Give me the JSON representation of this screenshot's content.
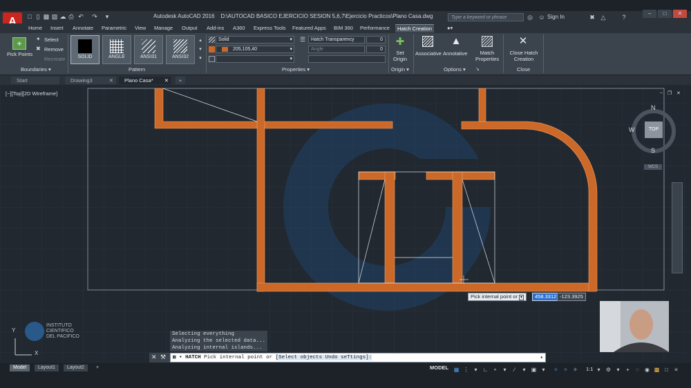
{
  "app": {
    "title": "Autodesk AutoCAD 2016",
    "file_path": "D:\\AUTOCAD BASICO EJERCICIO SESION 5,6,7\\Ejercicio Practicos\\Plano Casa.dwg",
    "search_placeholder": "Type a keyword or phrase",
    "signin": "Sign In",
    "logo_letter": "A"
  },
  "ribbon_tabs": [
    "Home",
    "Insert",
    "Annotate",
    "Parametric",
    "View",
    "Manage",
    "Output",
    "Add-ins",
    "A360",
    "Express Tools",
    "Featured Apps",
    "BIM 360",
    "Performance",
    "Hatch Creation"
  ],
  "ribbon": {
    "boundaries": {
      "title": "Boundaries",
      "pick_points": "Pick Points",
      "select": "Select",
      "remove": "Remove",
      "recreate": "Recreate"
    },
    "pattern": {
      "title": "Pattern",
      "items": [
        "SOLID",
        "ANGLE",
        "ANSI31",
        "ANSI32"
      ]
    },
    "properties": {
      "title": "Properties",
      "type": "Solid",
      "color": "205,105,40",
      "transparency_label": "Hatch Transparency",
      "transparency_value": "0",
      "angle_label": "Angle",
      "angle_value": "0"
    },
    "origin": {
      "title": "Origin",
      "set_origin": "Set Origin"
    },
    "options": {
      "title": "Options",
      "associative": "Associative",
      "annotative": "Annotative",
      "match_properties": "Match Properties"
    },
    "close": {
      "title": "Close",
      "close_label": "Close Hatch Creation"
    }
  },
  "doc_tabs": [
    "Start",
    "Drawing3",
    "Plano Casa*"
  ],
  "viewport": {
    "label": "[−][Top][2D Wireframe]",
    "viewcube": {
      "n": "N",
      "s": "S",
      "e": "E",
      "w": "W",
      "face": "TOP",
      "wcs": "WCS"
    },
    "tooltip": "Pick internal point or",
    "coord_x": "458.3312",
    "coord_y": "-123.3925",
    "watermark": {
      "line1": "INSTITUTO",
      "line2": "CIENTIFICO",
      "line3": "DEL PACIFICO"
    },
    "axis_x": "X",
    "axis_y": "Y"
  },
  "command": {
    "history": [
      "Selecting everything visible...",
      "Analyzing the selected data...",
      "Analyzing internal islands..."
    ],
    "prompt_cmd": "HATCH",
    "prompt_text": "Pick internal point or",
    "prompt_options": "[Select objects Undo seTtings]:"
  },
  "layout_tabs": [
    "Model",
    "Layout1",
    "Layout2"
  ],
  "status": {
    "model": "MODEL",
    "scale": "1:1"
  },
  "colors": {
    "hatch": "#cd6928",
    "background": "#212830",
    "ribbon": "#3b434c"
  }
}
